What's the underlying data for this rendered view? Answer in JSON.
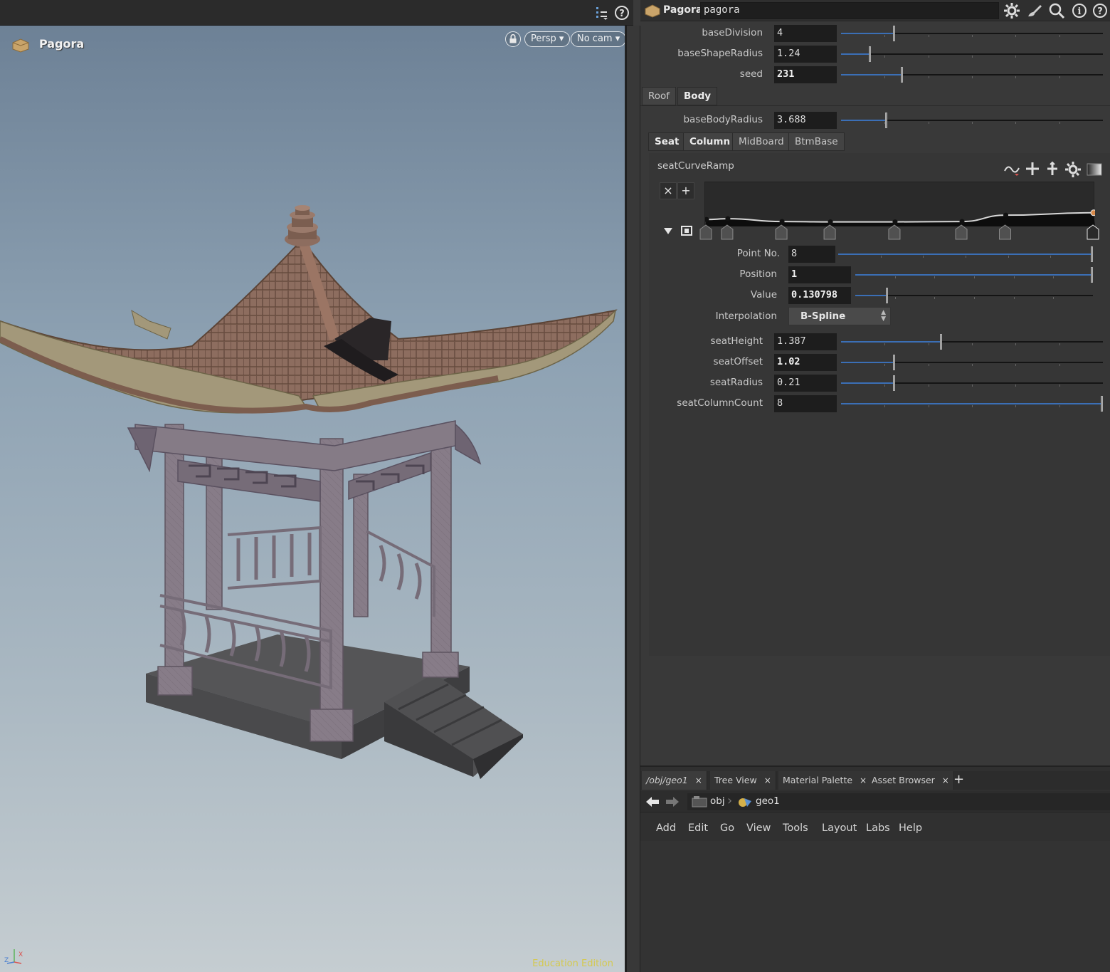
{
  "viewport": {
    "title": "Pagora",
    "view_mode": "Persp",
    "camera": "No cam",
    "watermark": "Education Edition"
  },
  "panel": {
    "node_type": "Pagora",
    "node_name": "pagora",
    "params": [
      {
        "label": "baseDivision",
        "value": "4",
        "frac": 0.2
      },
      {
        "label": "baseShapeRadius",
        "value": "1.24",
        "frac": 0.11
      },
      {
        "label": "seed",
        "value": "231",
        "frac": 0.23,
        "bold": true
      }
    ],
    "tabs_main": [
      "Roof",
      "Body"
    ],
    "body_params": [
      {
        "label": "baseBodyRadius",
        "value": "3.688",
        "frac": 0.17
      }
    ],
    "tabs_body": [
      "Seat",
      "Column",
      "MidBoard",
      "BtmBase"
    ],
    "ramp": {
      "label": "seatCurveRamp",
      "point_no_label": "Point No.",
      "point_no": "8",
      "position_label": "Position",
      "position": "1",
      "value_label": "Value",
      "value": "0.130798",
      "interp_label": "Interpolation",
      "interp": "B-Spline",
      "keys": [
        0.0,
        0.055,
        0.195,
        0.32,
        0.487,
        0.66,
        0.773,
        1.0
      ],
      "key_values": [
        0.12,
        0.14,
        0.07,
        0.06,
        0.06,
        0.07,
        0.23,
        0.29
      ]
    },
    "seat_params": [
      {
        "label": "seatHeight",
        "value": "1.387",
        "frac": 0.38
      },
      {
        "label": "seatOffset",
        "value": "1.02",
        "frac": 0.2,
        "bold": true
      },
      {
        "label": "seatRadius",
        "value": "0.21",
        "frac": 0.2
      },
      {
        "label": "seatColumnCount",
        "value": "8",
        "frac": 1.0
      }
    ]
  },
  "network": {
    "tabs": [
      "/obj/geo1",
      "Tree View",
      "Material Palette",
      "Asset Browser"
    ],
    "path": [
      "obj",
      "geo1"
    ],
    "menu": [
      "Add",
      "Edit",
      "Go",
      "View",
      "Tools",
      "Layout",
      "Labs",
      "Help"
    ]
  },
  "colors": {
    "slider_fill": "#3b6fb6",
    "roof_tile": "#8a6a5c",
    "roof_trim": "#a39a70",
    "structure": "#857b85",
    "base": "#4a4a4c",
    "watermark": "#d7c93a"
  }
}
